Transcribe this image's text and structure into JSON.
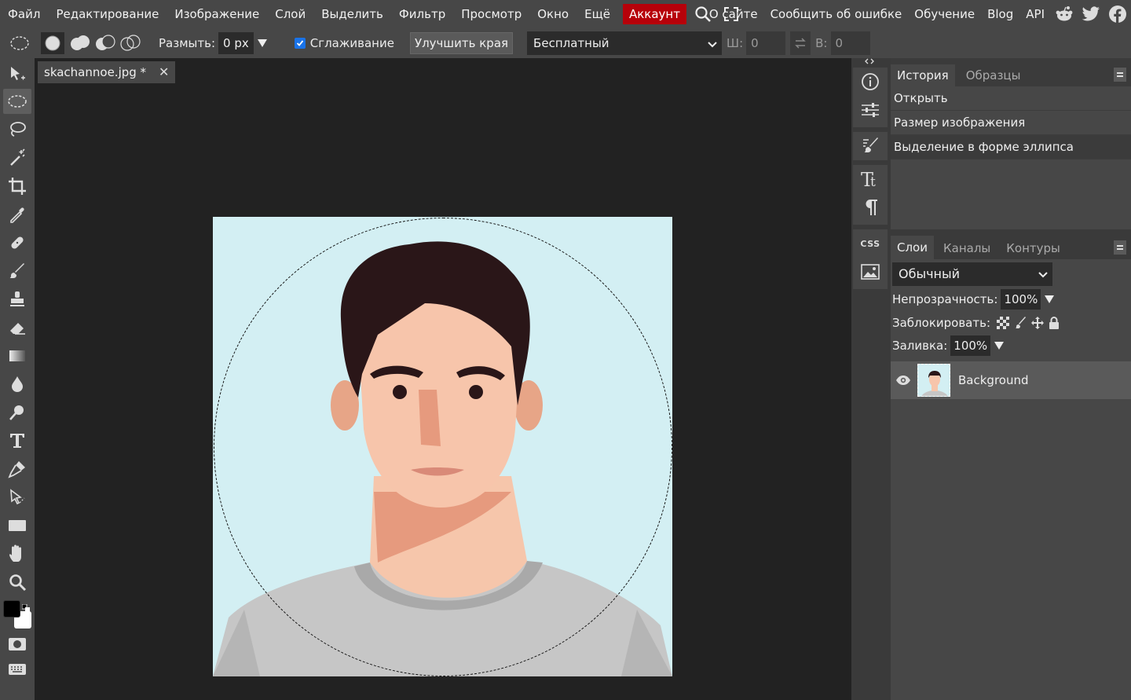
{
  "menu": {
    "items": [
      "Файл",
      "Редактирование",
      "Изображение",
      "Слой",
      "Выделить",
      "Фильтр",
      "Просмотр",
      "Окно",
      "Ещё"
    ],
    "account": "Аккаунт",
    "right_items": [
      "О сайте",
      "Сообщить об ошибке",
      "Обучение",
      "Blog",
      "API"
    ]
  },
  "options": {
    "feather_label": "Размыть:",
    "feather_value": "0 px",
    "antialias_label": "Сглаживание",
    "refine_label": "Улучшить края",
    "mode_value": "Бесплатный",
    "width_label": "Ш:",
    "width_value": "0",
    "height_label": "В:",
    "height_value": "0"
  },
  "document": {
    "tab_title": "skachannoe.jpg *",
    "close": "✕"
  },
  "history": {
    "tabs": [
      "История",
      "Образцы"
    ],
    "items": [
      "Открыть",
      "Размер изображения",
      "Выделение в форме эллипса"
    ],
    "selected_index": 2
  },
  "layers": {
    "tabs": [
      "Слои",
      "Каналы",
      "Контуры"
    ],
    "blend_mode": "Обычный",
    "opacity_label": "Непрозрачность:",
    "opacity_value": "100%",
    "lock_label": "Заблокировать:",
    "fill_label": "Заливка:",
    "fill_value": "100%",
    "layer_name": "Background"
  },
  "mid_panel": {
    "css_label": "CSS"
  },
  "colors": {
    "account_bg": "#b7010a",
    "canvas_bg": "#d3eff3",
    "foreground": "#000000",
    "background": "#ffffff"
  }
}
